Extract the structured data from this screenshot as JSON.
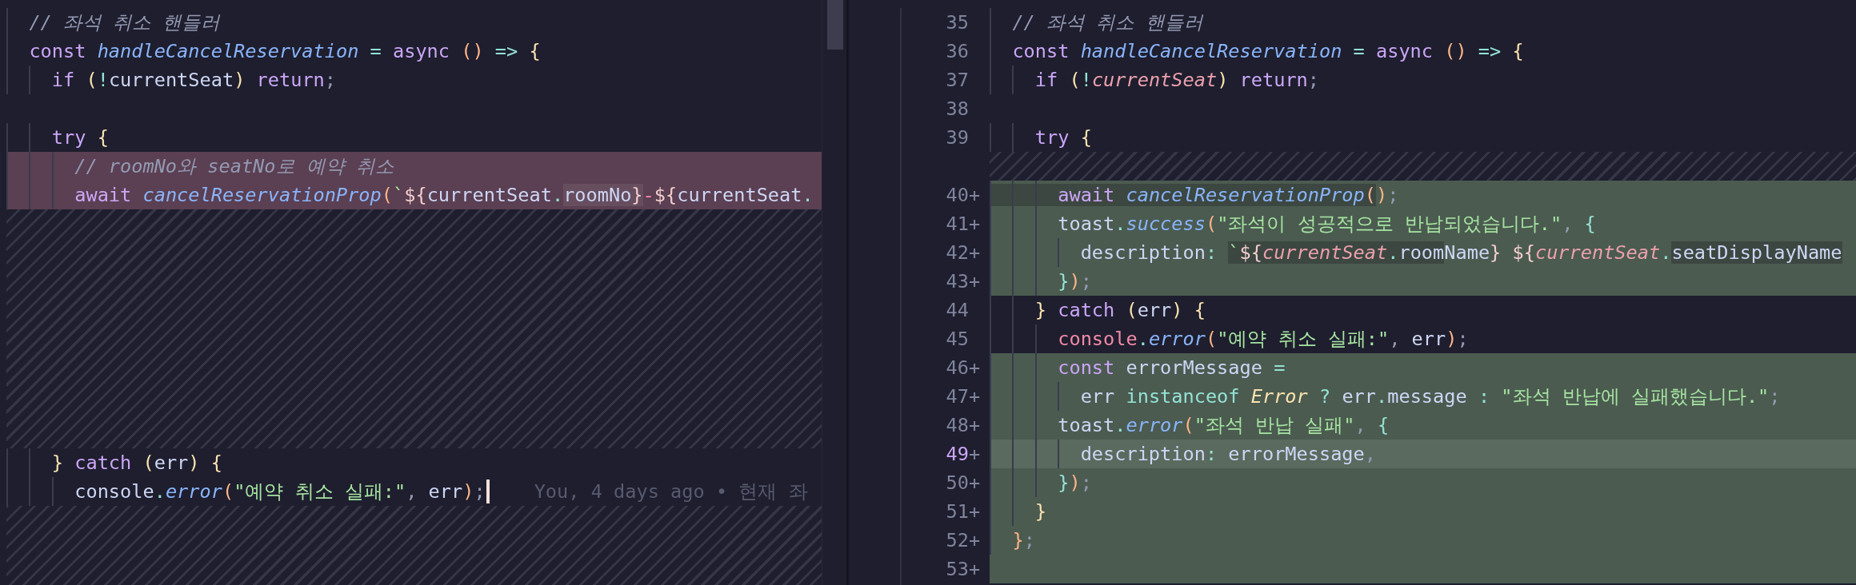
{
  "left_pane": {
    "lines": [
      {
        "kind": "normal",
        "tokens": [
          {
            "kind": "com",
            "text": "  // 좌석 취소 핸들러"
          }
        ]
      },
      {
        "kind": "normal",
        "tokens": [
          {
            "kind": "kw",
            "text": "  const "
          },
          {
            "kind": "fn",
            "text": "handleCancelReservation"
          },
          {
            "kind": "op",
            "text": " = "
          },
          {
            "kind": "kw",
            "text": "async "
          },
          {
            "kind": "paren",
            "text": "()"
          },
          {
            "kind": "op",
            "text": " => "
          },
          {
            "kind": "brace",
            "text": "{"
          }
        ]
      },
      {
        "kind": "normal",
        "tokens": [
          {
            "kind": "kw",
            "text": "    if "
          },
          {
            "kind": "brace",
            "text": "("
          },
          {
            "kind": "op",
            "text": "!"
          },
          {
            "kind": "plain",
            "text": "currentSeat"
          },
          {
            "kind": "brace",
            "text": ")"
          },
          {
            "kind": "kw",
            "text": " return"
          },
          {
            "kind": "punct",
            "text": ";"
          }
        ]
      },
      {
        "kind": "normal"
      },
      {
        "kind": "normal",
        "tokens": [
          {
            "kind": "kw",
            "text": "    try "
          },
          {
            "kind": "brace",
            "text": "{"
          }
        ]
      },
      {
        "kind": "deleted",
        "tokens": [
          {
            "kind": "com",
            "text": "      // roomNo와 seatNo로 예약 취소"
          }
        ]
      },
      {
        "kind": "deleted",
        "tokens": [
          {
            "kind": "kw",
            "text": "      await "
          },
          {
            "kind": "fn",
            "text": "cancelReservationProp"
          },
          {
            "kind": "paren",
            "text": "("
          },
          {
            "kind": "str",
            "text": "`"
          },
          {
            "kind": "tpl",
            "text": "${"
          },
          {
            "kind": "plain",
            "text": "currentSeat"
          },
          {
            "kind": "op",
            "text": "."
          },
          {
            "kind": "plain",
            "text": "roomNo",
            "changed": true
          },
          {
            "kind": "tpl",
            "text": "}",
            "changed": true
          },
          {
            "kind": "red",
            "text": "-"
          },
          {
            "kind": "tpl",
            "text": "${"
          },
          {
            "kind": "plain",
            "text": "currentSeat"
          },
          {
            "kind": "op",
            "text": "."
          }
        ]
      },
      {
        "kind": "filler"
      },
      {
        "kind": "filler"
      },
      {
        "kind": "filler"
      },
      {
        "kind": "normal",
        "tokens": [
          {
            "kind": "brace",
            "text": "    }"
          },
          {
            "kind": "kw",
            "text": " catch "
          },
          {
            "kind": "brace",
            "text": "("
          },
          {
            "kind": "plain",
            "text": "err"
          },
          {
            "kind": "brace",
            "text": ")"
          },
          {
            "kind": "brace",
            "text": " {"
          }
        ]
      },
      {
        "kind": "normal",
        "cursor": true,
        "blame": "You, 4 days ago • 현재 좌",
        "tokens": [
          {
            "kind": "plain",
            "text": "      console"
          },
          {
            "kind": "op",
            "text": "."
          },
          {
            "kind": "fn",
            "text": "error"
          },
          {
            "kind": "paren",
            "text": "("
          },
          {
            "kind": "str",
            "text": "\"예약 취소 실패:\""
          },
          {
            "kind": "punct",
            "text": ", "
          },
          {
            "kind": "plain",
            "text": "err"
          },
          {
            "kind": "paren",
            "text": ")"
          },
          {
            "kind": "punct",
            "text": ";"
          }
        ]
      }
    ]
  },
  "right_pane": {
    "lines": [
      {
        "kind": "normal",
        "number": "35",
        "tokens": [
          {
            "kind": "com",
            "text": "  // 좌석 취소 핸들러"
          }
        ]
      },
      {
        "kind": "normal",
        "number": "36",
        "tokens": [
          {
            "kind": "kw",
            "text": "  const "
          },
          {
            "kind": "fn",
            "text": "handleCancelReservation"
          },
          {
            "kind": "op",
            "text": " = "
          },
          {
            "kind": "kw",
            "text": "async "
          },
          {
            "kind": "paren",
            "text": "()"
          },
          {
            "kind": "op",
            "text": " => "
          },
          {
            "kind": "brace",
            "text": "{"
          }
        ]
      },
      {
        "kind": "normal",
        "number": "37",
        "tokens": [
          {
            "kind": "kw",
            "text": "    if "
          },
          {
            "kind": "brace",
            "text": "("
          },
          {
            "kind": "op",
            "text": "!"
          },
          {
            "kind": "param",
            "text": "currentSeat"
          },
          {
            "kind": "brace",
            "text": ")"
          },
          {
            "kind": "kw",
            "text": " return"
          },
          {
            "kind": "punct",
            "text": ";"
          }
        ]
      },
      {
        "kind": "normal",
        "number": "38"
      },
      {
        "kind": "normal",
        "number": "39",
        "tokens": [
          {
            "kind": "kw",
            "text": "    try "
          },
          {
            "kind": "brace",
            "text": "{"
          }
        ]
      },
      {
        "kind": "filler"
      },
      {
        "kind": "added",
        "number": "40",
        "marker": "+",
        "tokens": [
          {
            "kind": "kw",
            "text": "      await ",
            "changed": true
          },
          {
            "kind": "fn",
            "text": "cancelReservationProp",
            "changed": true
          },
          {
            "kind": "paren",
            "text": "(",
            "changed": true
          },
          {
            "kind": "paren",
            "text": ")"
          },
          {
            "kind": "punct",
            "text": ";"
          }
        ]
      },
      {
        "kind": "added",
        "number": "41",
        "marker": "+",
        "tokens": [
          {
            "kind": "plain",
            "text": "      toast"
          },
          {
            "kind": "op",
            "text": "."
          },
          {
            "kind": "fn",
            "text": "success"
          },
          {
            "kind": "paren",
            "text": "("
          },
          {
            "kind": "str",
            "text": "\"좌석이 성공적으로 반납되었습니다.\""
          },
          {
            "kind": "punct",
            "text": ", "
          },
          {
            "kind": "op",
            "text": "{"
          }
        ]
      },
      {
        "kind": "added",
        "number": "42",
        "marker": "+",
        "tokens": [
          {
            "kind": "plain",
            "text": "        description"
          },
          {
            "kind": "op",
            "text": ": "
          },
          {
            "kind": "str",
            "text": "`",
            "changed": true
          },
          {
            "kind": "tpl",
            "text": "${",
            "changed": true
          },
          {
            "kind": "param",
            "text": "currentSeat",
            "changed": true
          },
          {
            "kind": "op",
            "text": ".",
            "changed": true
          },
          {
            "kind": "plain",
            "text": "room",
            "changed": true
          },
          {
            "kind": "plain",
            "text": "Name"
          },
          {
            "kind": "tpl",
            "text": "}"
          },
          {
            "kind": "tpl",
            "text": " ${"
          },
          {
            "kind": "param",
            "text": "currentSeat"
          },
          {
            "kind": "op",
            "text": "."
          },
          {
            "kind": "plain",
            "text": "seatDisplayName",
            "changed": true
          }
        ]
      },
      {
        "kind": "added",
        "number": "43",
        "marker": "+",
        "tokens": [
          {
            "kind": "op",
            "text": "      }"
          },
          {
            "kind": "paren",
            "text": ")"
          },
          {
            "kind": "punct",
            "text": ";"
          }
        ]
      },
      {
        "kind": "normal",
        "number": "44",
        "tokens": [
          {
            "kind": "brace",
            "text": "    }"
          },
          {
            "kind": "kw",
            "text": " catch "
          },
          {
            "kind": "brace",
            "text": "("
          },
          {
            "kind": "plain",
            "text": "err"
          },
          {
            "kind": "brace",
            "text": ")"
          },
          {
            "kind": "brace",
            "text": " {"
          }
        ]
      },
      {
        "kind": "normal",
        "number": "45",
        "tokens": [
          {
            "kind": "red",
            "text": "      console"
          },
          {
            "kind": "op",
            "text": "."
          },
          {
            "kind": "fn",
            "text": "error"
          },
          {
            "kind": "paren",
            "text": "("
          },
          {
            "kind": "str",
            "text": "\"예약 취소 실패:\""
          },
          {
            "kind": "punct",
            "text": ", "
          },
          {
            "kind": "plain",
            "text": "err"
          },
          {
            "kind": "paren",
            "text": ")"
          },
          {
            "kind": "punct",
            "text": ";"
          }
        ]
      },
      {
        "kind": "added",
        "number": "46",
        "marker": "+",
        "tokens": [
          {
            "kind": "kw",
            "text": "      const "
          },
          {
            "kind": "plain",
            "text": "errorMessage"
          },
          {
            "kind": "op",
            "text": " ="
          }
        ]
      },
      {
        "kind": "added",
        "number": "47",
        "marker": "+",
        "tokens": [
          {
            "kind": "plain",
            "text": "        err "
          },
          {
            "kind": "op",
            "text": "instanceof "
          },
          {
            "kind": "type",
            "text": "Error"
          },
          {
            "kind": "op",
            "text": " ? "
          },
          {
            "kind": "plain",
            "text": "err"
          },
          {
            "kind": "op",
            "text": "."
          },
          {
            "kind": "plain",
            "text": "message"
          },
          {
            "kind": "op",
            "text": " : "
          },
          {
            "kind": "str",
            "text": "\"좌석 반납에 실패했습니다.\""
          },
          {
            "kind": "punct",
            "text": ";"
          }
        ]
      },
      {
        "kind": "added",
        "number": "48",
        "marker": "+",
        "tokens": [
          {
            "kind": "plain",
            "text": "      toast"
          },
          {
            "kind": "op",
            "text": "."
          },
          {
            "kind": "fn",
            "text": "error"
          },
          {
            "kind": "paren",
            "text": "("
          },
          {
            "kind": "str",
            "text": "\"좌석 반납 실패\""
          },
          {
            "kind": "punct",
            "text": ", "
          },
          {
            "kind": "op",
            "text": "{"
          }
        ]
      },
      {
        "kind": "added",
        "number": "49",
        "marker": "+",
        "current": true,
        "tokens": [
          {
            "kind": "plain",
            "text": "        description"
          },
          {
            "kind": "op",
            "text": ": "
          },
          {
            "kind": "plain",
            "text": "errorMessage"
          },
          {
            "kind": "punct",
            "text": ","
          }
        ]
      },
      {
        "kind": "added",
        "number": "50",
        "marker": "+",
        "tokens": [
          {
            "kind": "op",
            "text": "      }"
          },
          {
            "kind": "paren",
            "text": ")"
          },
          {
            "kind": "punct",
            "text": ";"
          }
        ]
      },
      {
        "kind": "added",
        "number": "51",
        "marker": "+",
        "tokens": [
          {
            "kind": "brace",
            "text": "    }"
          }
        ]
      },
      {
        "kind": "added",
        "number": "52",
        "marker": "+",
        "tokens": [
          {
            "kind": "paren",
            "text": "  }"
          },
          {
            "kind": "punct",
            "text": ";"
          }
        ]
      },
      {
        "kind": "added",
        "number": "53",
        "marker": "+"
      }
    ]
  }
}
